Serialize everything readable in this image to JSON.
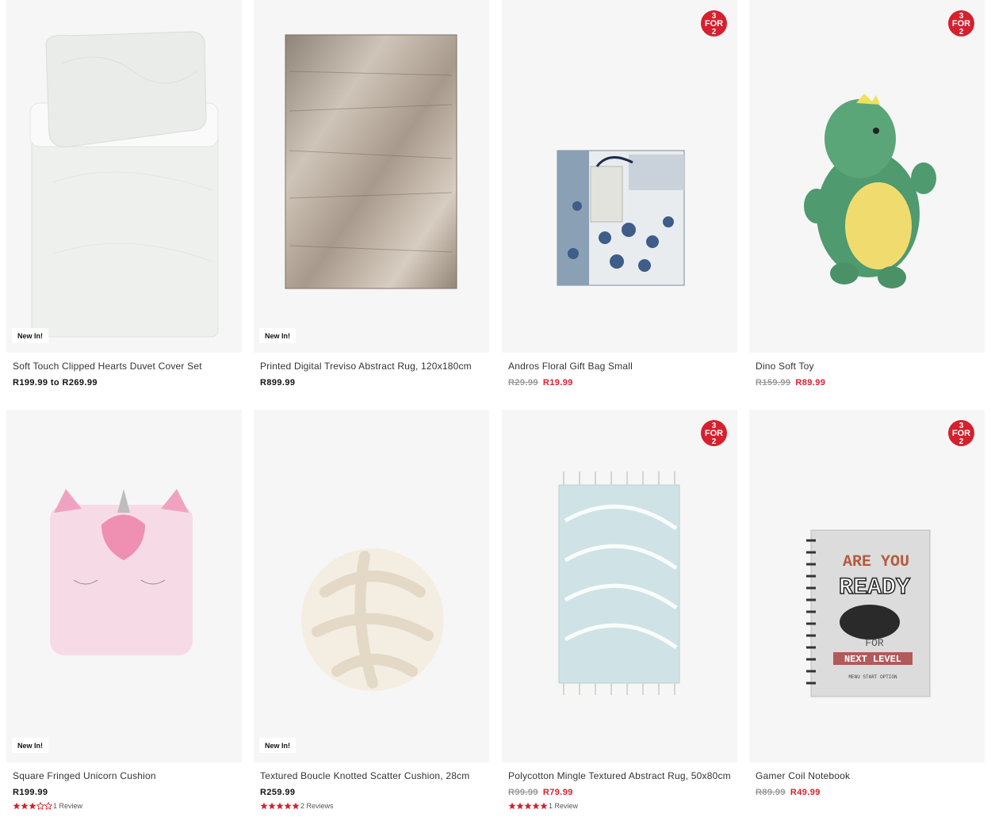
{
  "colors": {
    "sale": "#d5202e",
    "strike": "#999999",
    "tile": "#f6f6f6",
    "star": "#d5202e"
  },
  "promo_badge": {
    "top": "3",
    "mid": "FOR",
    "bottom": "2"
  },
  "products": [
    {
      "name": "Soft Touch Clipped Hearts Duvet Cover Set",
      "price": "R199.99 to R269.99",
      "was": "",
      "now": "",
      "badge_new": "New In!",
      "promo": false,
      "image": "duvet-cover-set"
    },
    {
      "name": "Printed Digital Treviso Abstract Rug, 120x180cm",
      "price": "R899.99",
      "was": "",
      "now": "",
      "badge_new": "New In!",
      "promo": false,
      "image": "abstract-rug"
    },
    {
      "name": "Andros Floral Gift Bag Small",
      "price": "",
      "was": "R29.99",
      "now": "R19.99",
      "badge_new": "",
      "promo": true,
      "image": "floral-gift-bag"
    },
    {
      "name": "Dino Soft Toy",
      "price": "",
      "was": "R159.99",
      "now": "R89.99",
      "badge_new": "",
      "promo": true,
      "image": "dino-soft-toy"
    },
    {
      "name": "Square Fringed Unicorn Cushion",
      "price": "R199.99",
      "was": "",
      "now": "",
      "badge_new": "New In!",
      "promo": false,
      "image": "unicorn-cushion",
      "rating": 3,
      "reviews": "1 Review"
    },
    {
      "name": "Textured Boucle Knotted Scatter Cushion, 28cm",
      "price": "R259.99",
      "was": "",
      "now": "",
      "badge_new": "New In!",
      "promo": false,
      "image": "knot-cushion",
      "rating": 5,
      "reviews": "2 Reviews"
    },
    {
      "name": "Polycotton Mingle Textured Abstract Rug, 50x80cm",
      "price": "",
      "was": "R99.99",
      "now": "R79.99",
      "badge_new": "",
      "promo": true,
      "image": "textured-rug",
      "rating": 5,
      "reviews": "1 Review"
    },
    {
      "name": "Gamer Coil Notebook",
      "price": "",
      "was": "R89.99",
      "now": "R49.99",
      "badge_new": "",
      "promo": true,
      "image": "gamer-notebook",
      "notebook_text": [
        "ARE YOU",
        "READY",
        "FOR",
        "NEXT LEVEL",
        "MENU START OPTION"
      ]
    }
  ]
}
